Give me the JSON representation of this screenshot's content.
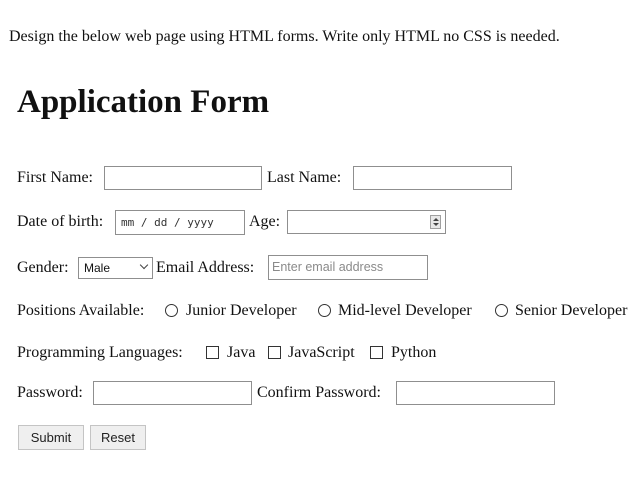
{
  "prompt": "Design the below web page using HTML forms. Write only HTML no CSS is needed.",
  "form": {
    "title": "Application Form",
    "first_name_label": "First Name:",
    "last_name_label": "Last Name:",
    "dob_label": "Date of birth:",
    "dob_placeholder": "mm / dd / yyyy",
    "age_label": "Age:",
    "gender_label": "Gender:",
    "gender_selected": "Male",
    "email_label": "Email Address:",
    "email_placeholder": "Enter email address",
    "positions_label": "Positions Available:",
    "positions": [
      "Junior Developer",
      "Mid-level Developer",
      "Senior Developer"
    ],
    "languages_label": "Programming Languages:",
    "languages": [
      "Java",
      "JavaScript",
      "Python"
    ],
    "password_label": "Password:",
    "confirm_password_label": "Confirm Password:",
    "submit_label": "Submit",
    "reset_label": "Reset"
  }
}
